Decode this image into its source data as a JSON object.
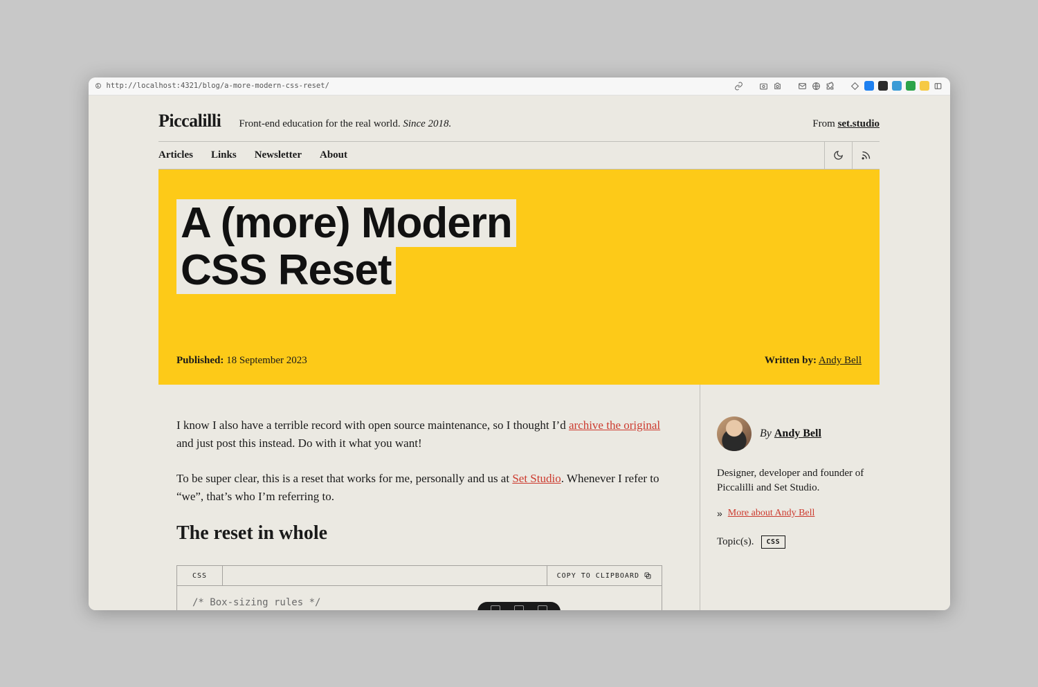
{
  "browser": {
    "url": "http://localhost:4321/blog/a-more-modern-css-reset/"
  },
  "site": {
    "brand": "Piccalilli",
    "tagline_plain": "Front-end education for the real world. ",
    "tagline_em": "Since 2018.",
    "from_label": "From ",
    "from_link": "set.studio"
  },
  "nav": {
    "items": [
      "Articles",
      "Links",
      "Newsletter",
      "About"
    ]
  },
  "hero": {
    "title_line1": "A (more) Modern",
    "title_line2": "CSS Reset",
    "published_label": "Published:",
    "published_date": "18 September 2023",
    "written_label": "Written by:",
    "author": "Andy Bell"
  },
  "article": {
    "p1_a": "I know I also have a terrible record with open source maintenance, so I thought I’d ",
    "p1_link": "archive the original",
    "p1_b": " and just post this instead. Do with it what you want!",
    "p2_a": "To be super clear, this is a reset that works for me, personally and us at ",
    "p2_link": "Set Studio",
    "p2_b": ". Whenever I refer to “we”, that’s who I’m referring to.",
    "h2": "The reset in whole"
  },
  "code": {
    "lang": "CSS",
    "copy_label": "COPY TO CLIPBOARD",
    "first_line": "/* Box-sizing rules */"
  },
  "aside": {
    "by": "By ",
    "author": "Andy Bell",
    "bio": "Designer, developer and founder of Piccalilli and Set Studio.",
    "more": "More about Andy Bell",
    "topics_label": "Topic(s).",
    "tag": "CSS"
  }
}
